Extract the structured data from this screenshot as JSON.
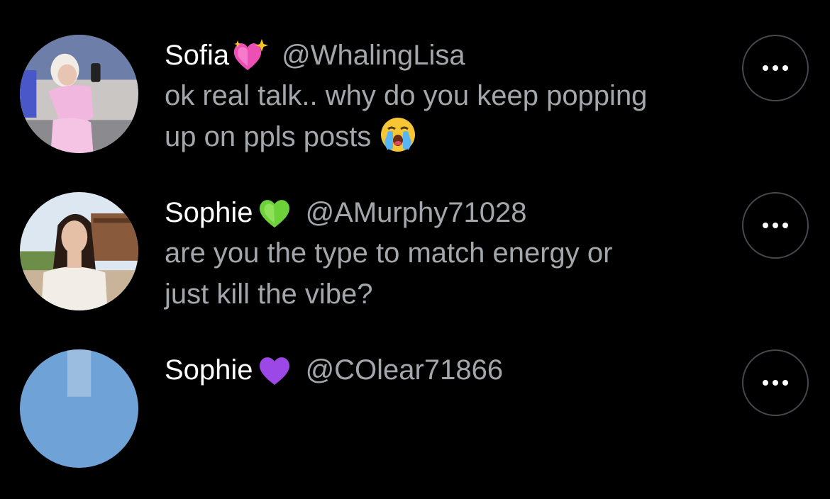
{
  "replies": [
    {
      "name": "Sofia",
      "badge_icon": "sparkling-heart-emoji",
      "handle": "@WhalingLisa",
      "text_lines": [
        "ok real talk.. why do you keep popping",
        "up on ppls posts"
      ],
      "trailing_emoji": "crying-face-emoji"
    },
    {
      "name": "Sophie",
      "badge_icon": "green-heart-emoji",
      "handle": "@AMurphy71028",
      "text_lines": [
        "are you the type to match energy or",
        "just kill the vibe?"
      ]
    },
    {
      "name": "Sophie",
      "badge_icon": "purple-heart-emoji",
      "handle": "@COlear71866",
      "text_lines": []
    }
  ],
  "more_icon": "more-options-icon",
  "colors": {
    "background": "#000000",
    "name": "#ffffff",
    "secondary_text": "#a3a6ab",
    "button_border": "#45484d"
  }
}
